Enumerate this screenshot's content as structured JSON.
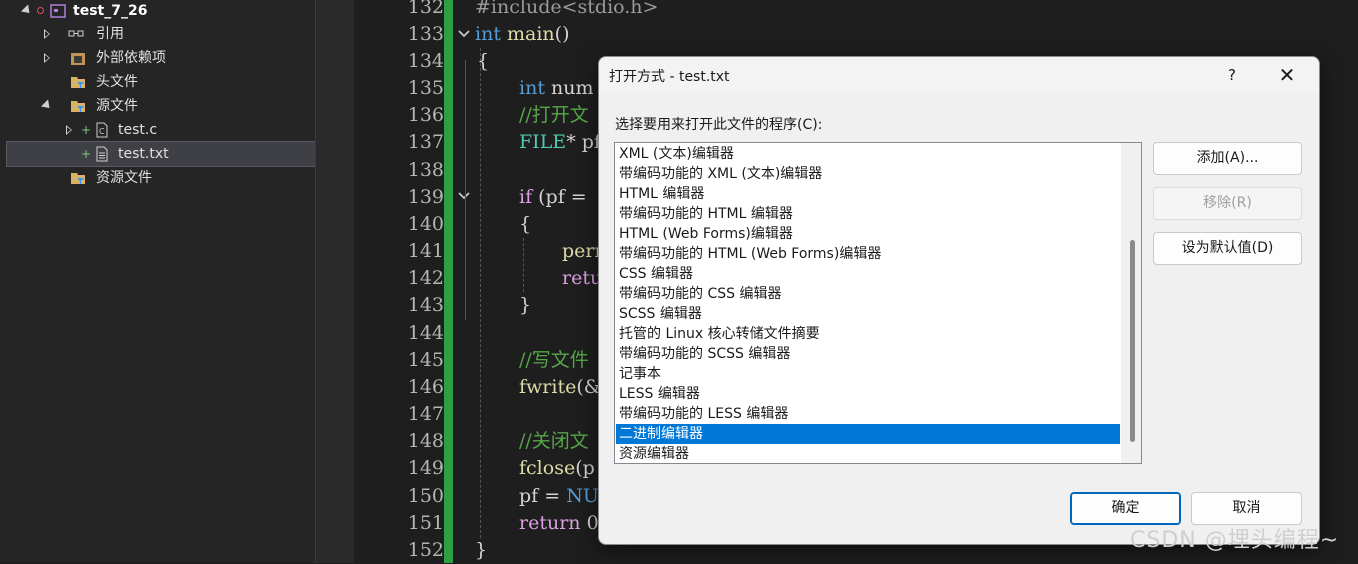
{
  "solution_explorer": {
    "project": "test_7_26",
    "items": [
      {
        "label": "引用"
      },
      {
        "label": "外部依赖项"
      },
      {
        "label": "头文件"
      },
      {
        "label": "源文件"
      },
      {
        "label": "test.c"
      },
      {
        "label": "test.txt"
      },
      {
        "label": "资源文件"
      }
    ]
  },
  "editor": {
    "line_numbers": [
      "132",
      "133",
      "134",
      "135",
      "136",
      "137",
      "138",
      "139",
      "140",
      "141",
      "142",
      "143",
      "144",
      "145",
      "146",
      "147",
      "148",
      "149",
      "150",
      "151",
      "152"
    ],
    "lines": {
      "l132": "#include<stdio.h>",
      "l133_kw": "int",
      "l133_fn": " main",
      "l133_rest": "()",
      "l134": "{",
      "l135_kw": "int",
      "l135_rest": " num",
      "l136": "//打开文",
      "l137_ty": "FILE",
      "l137_rest": "* pf",
      "l139_kw": "if",
      "l139_rest": " (pf =",
      "l140": "{",
      "l141": "perr",
      "l142": "retu",
      "l143": "}",
      "l145": "//写文件",
      "l146_fn": "fwrite",
      "l146_rest": "(&",
      "l148": "//关闭文",
      "l149_fn": "fclose",
      "l149_rest": "(p",
      "l150_tx": "pf = ",
      "l150_kw": "NUL",
      "l151_ctl": "return",
      "l151_rest": " 0",
      "l152": "}"
    }
  },
  "dialog": {
    "title": "打开方式 - test.txt",
    "help": "?",
    "close": "✕",
    "prompt": "选择要用来打开此文件的程序(C):",
    "programs": [
      "XML (文本)编辑器",
      "带编码功能的 XML (文本)编辑器",
      "HTML 编辑器",
      "带编码功能的 HTML 编辑器",
      "HTML (Web Forms)编辑器",
      "带编码功能的 HTML (Web Forms)编辑器",
      "CSS 编辑器",
      "带编码功能的 CSS 编辑器",
      "SCSS 编辑器",
      "托管的 Linux 核心转储文件摘要",
      "带编码功能的 SCSS 编辑器",
      "记事本",
      "LESS 编辑器",
      "带编码功能的 LESS 编辑器",
      "二进制编辑器",
      "资源编辑器"
    ],
    "selected_program": "二进制编辑器",
    "buttons": {
      "add": "添加(A)...",
      "remove": "移除(R)",
      "set_default": "设为默认值(D)",
      "ok": "确定",
      "cancel": "取消"
    }
  },
  "watermark": "CSDN @埋头编程~",
  "colors": {
    "selection": "#0078d7",
    "change_bar": "#2ea043",
    "keyword": "#569cd6"
  }
}
